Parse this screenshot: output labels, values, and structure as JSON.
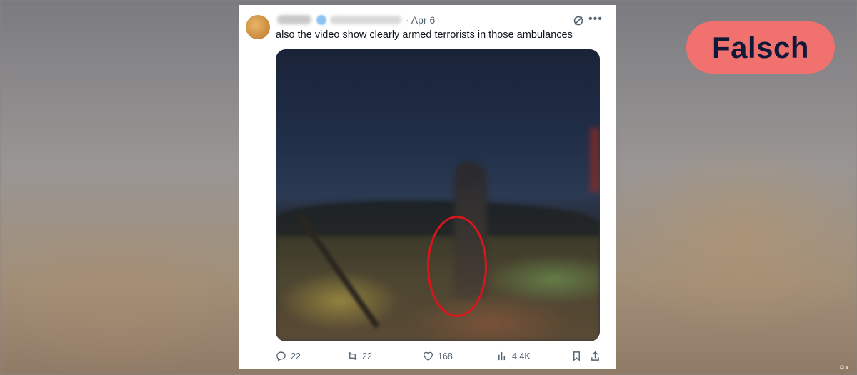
{
  "tweet": {
    "date": "· Apr 6",
    "text": "also the video show clearly armed terrorists in those ambulances",
    "stats": {
      "replies": "22",
      "reposts": "22",
      "likes": "168",
      "views": "4.4K"
    }
  },
  "verdict_badge": "Falsch",
  "credit": "© x",
  "colors": {
    "badge_bg": "#f0716d",
    "badge_text": "#0f1a3a",
    "annotation_circle": "#d8161b",
    "secondary_text": "#536471"
  },
  "icons": [
    "grok-icon",
    "more-icon",
    "reply-icon",
    "repost-icon",
    "like-icon",
    "views-icon",
    "bookmark-icon",
    "share-icon"
  ]
}
